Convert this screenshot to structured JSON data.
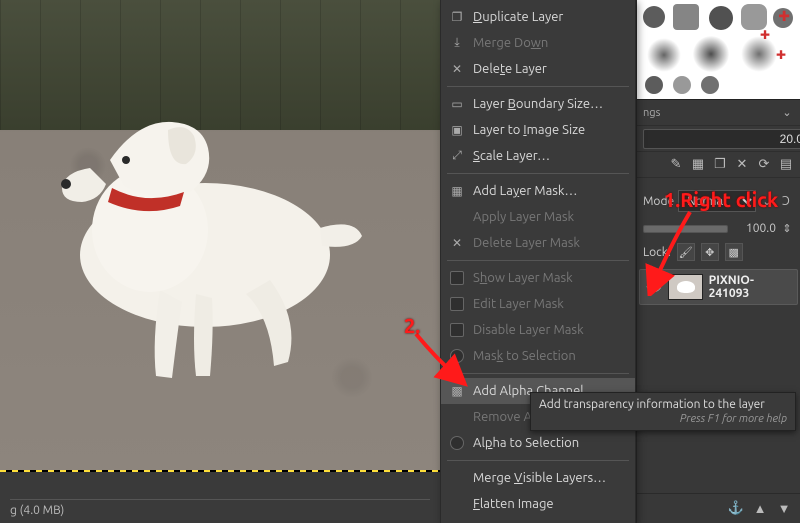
{
  "menu": {
    "duplicate": "Duplicate Layer",
    "merge_down": "Merge Down",
    "delete_layer": "Delete Layer",
    "boundary": "Layer Boundary Size…",
    "to_image": "Layer to Image Size",
    "scale": "Scale Layer…",
    "add_mask": "Add Layer Mask…",
    "apply_mask": "Apply Layer Mask",
    "delete_mask": "Delete Layer Mask",
    "show_mask": "Show Layer Mask",
    "edit_mask": "Edit Layer Mask",
    "disable_mask": "Disable Layer Mask",
    "mask_to_sel": "Mask to Selection",
    "add_alpha": "Add Alpha Channel",
    "remove_alpha": "Remove Alpha Channel",
    "alpha_to_sel": "Alpha to Selection",
    "merge_visible": "Merge Visible Layers…",
    "flatten": "Flatten Image"
  },
  "panel": {
    "spacing_label": "",
    "spacing_value": "20.0",
    "mode_label": "Mode",
    "mode_value": "Normal",
    "opacity_value": "100.0",
    "lock_label": "Lock:",
    "layer_name": "PIXNIO-241093"
  },
  "tooltip": {
    "main": "Add transparency information to the layer",
    "sub": "Press F1 for more help"
  },
  "status": {
    "text": "g (4.0 MB)"
  },
  "annotation": {
    "label1": "1.Right click",
    "label2": "2."
  }
}
